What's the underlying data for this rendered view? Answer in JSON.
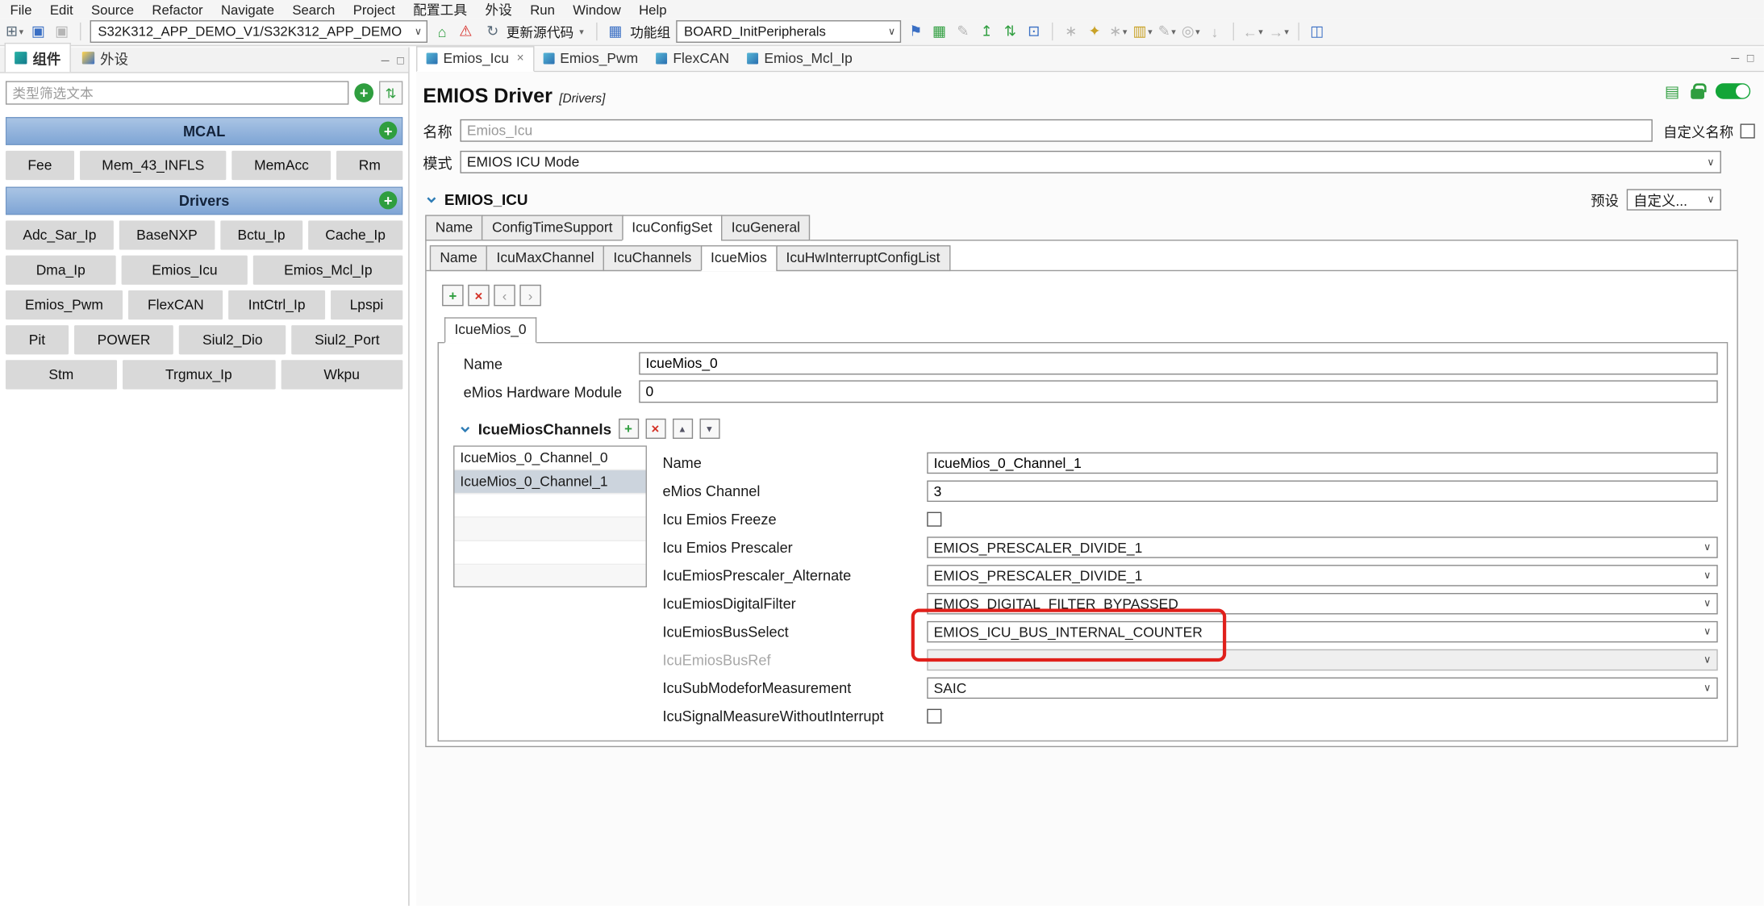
{
  "window": {
    "menu_items": [
      "File",
      "Edit",
      "Source",
      "Refactor",
      "Navigate",
      "Search",
      "Project",
      "配置工具",
      "外设",
      "Run",
      "Window",
      "Help"
    ]
  },
  "toolbar": {
    "project_selector": "S32K312_APP_DEMO_V1/S32K312_APP_DEMO",
    "update_code": "更新源代码",
    "functional_group_label": "功能组",
    "functional_group_value": "BOARD_InitPeripherals"
  },
  "icons": {
    "new": "⊞",
    "caret": "▾",
    "save": "▣",
    "home": "⌂",
    "warning": "⚠",
    "refresh": "↻",
    "grid_blue": "▦",
    "flag": "⚑",
    "grid_green": "▦",
    "pencil": "✎",
    "import": "↥",
    "sort": "⇅",
    "console": "⊡",
    "settings": "∗",
    "key": "✦",
    "package": "▥",
    "search": "◎",
    "down": "↓",
    "back": "←",
    "forward": "→",
    "chart": "◫",
    "plus": "+",
    "cross": "×",
    "chev_left": "‹",
    "chev_right": "›",
    "up_small": "▲",
    "down_small": "▼",
    "select_caret": "∨",
    "close": "×",
    "minimize": "─",
    "restore": "□",
    "doc": "▤"
  },
  "left_panel": {
    "tab_components": "组件",
    "tab_peripherals": "外设",
    "filter_placeholder": "类型筛选文本",
    "mcal": {
      "title": "MCAL",
      "items": [
        "Fee",
        "Mem_43_INFLS",
        "MemAcc",
        "Rm"
      ]
    },
    "drivers": {
      "title": "Drivers",
      "items": [
        "Adc_Sar_Ip",
        "BaseNXP",
        "Bctu_Ip",
        "Cache_Ip",
        "Dma_Ip",
        "Emios_Icu",
        "Emios_Mcl_Ip",
        "Emios_Pwm",
        "FlexCAN",
        "IntCtrl_Ip",
        "Lpspi",
        "Pit",
        "POWER",
        "Siul2_Dio",
        "Siul2_Port",
        "Stm",
        "Trgmux_Ip",
        "Wkpu"
      ]
    }
  },
  "editor": {
    "tabs": [
      "Emios_Icu",
      "Emios_Pwm",
      "FlexCAN",
      "Emios_Mcl_Ip"
    ],
    "active_tab": "Emios_Icu",
    "title": "EMIOS Driver",
    "title_tag": "[Drivers]",
    "name_label": "名称",
    "name_value": "Emios_Icu",
    "custom_name_label": "自定义名称",
    "custom_name_checked": false,
    "mode_label": "模式",
    "mode_value": "EMIOS ICU Mode"
  },
  "emios_icu": {
    "section_title": "EMIOS_ICU",
    "preset_label": "预设",
    "preset_value": "自定义...",
    "tabs": [
      "Name",
      "ConfigTimeSupport",
      "IcuConfigSet",
      "IcuGeneral"
    ],
    "active_tab": "IcuConfigSet",
    "configset_tabs": [
      "Name",
      "IcuMaxChannel",
      "IcuChannels",
      "IcueMios",
      "IcuHwInterruptConfigList"
    ],
    "configset_active_tab": "IcueMios",
    "mios_instance_tab": "IcueMios_0",
    "mios_name_label": "Name",
    "mios_name_value": "IcueMios_0",
    "hw_module_label": "eMios Hardware Module",
    "hw_module_value": "0",
    "channels": {
      "section_title": "IcueMiosChannels",
      "items": [
        "IcueMios_0_Channel_0",
        "IcueMios_0_Channel_1"
      ],
      "selected_item": "IcueMios_0_Channel_1",
      "rows": [
        {
          "label": "Name",
          "type": "input",
          "value": "IcueMios_0_Channel_1"
        },
        {
          "label": "eMios Channel",
          "type": "input",
          "value": "3"
        },
        {
          "label": "Icu Emios Freeze",
          "type": "checkbox",
          "checked": false
        },
        {
          "label": "Icu Emios Prescaler",
          "type": "select",
          "value": "EMIOS_PRESCALER_DIVIDE_1"
        },
        {
          "label": "IcuEmiosPrescaler_Alternate",
          "type": "select",
          "value": "EMIOS_PRESCALER_DIVIDE_1"
        },
        {
          "label": "IcuEmiosDigitalFilter",
          "type": "select",
          "value": "EMIOS_DIGITAL_FILTER_BYPASSED"
        },
        {
          "label": "IcuEmiosBusSelect",
          "type": "select",
          "value": "EMIOS_ICU_BUS_INTERNAL_COUNTER",
          "highlighted": true
        },
        {
          "label": "IcuEmiosBusRef",
          "type": "select",
          "value": "",
          "disabled": true
        },
        {
          "label": "IcuSubModeforMeasurement",
          "type": "select",
          "value": "SAIC"
        },
        {
          "label": "IcuSignalMeasureWithoutInterrupt",
          "type": "checkbox",
          "checked": false
        }
      ]
    },
    "highlight_color": "#e0201b"
  }
}
